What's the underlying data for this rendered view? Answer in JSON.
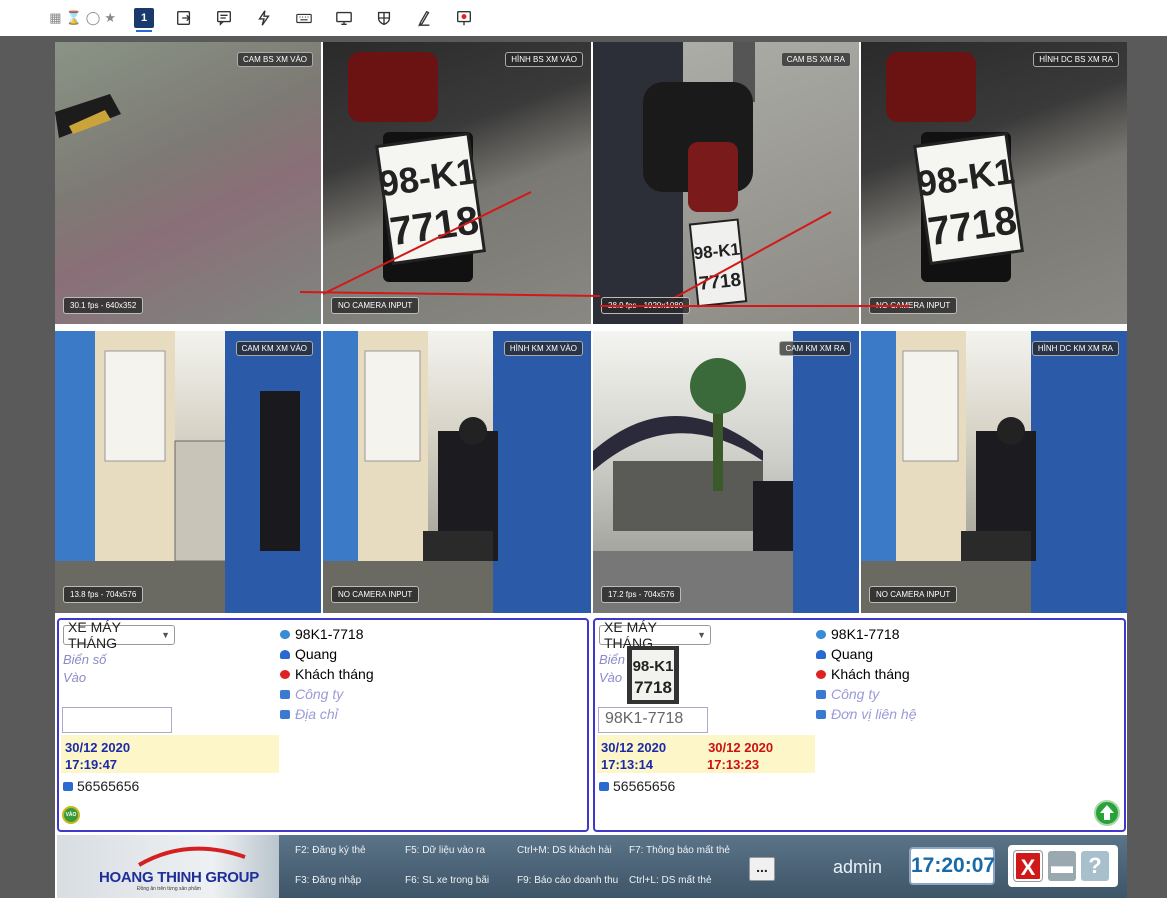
{
  "toolbar": {
    "left_icons": [
      "ruler-icon",
      "hourglass-icon",
      "cylinder-icon",
      "star-icon"
    ],
    "active_page": "1",
    "icons": [
      "page-1-icon",
      "exit-icon",
      "comment-icon",
      "bolt-icon",
      "keyboard-icon",
      "monitor-icon",
      "shield-icon",
      "pen-icon",
      "presentation-icon"
    ]
  },
  "cameras": [
    {
      "label": "CAM BS XM VÀO",
      "stat": "30.1 fps - 640x352"
    },
    {
      "label": "HÌNH BS XM VÀO",
      "stat": "NO CAMERA INPUT"
    },
    {
      "label": "CAM BS XM RA",
      "stat": "28.9 fps - 1920x1080"
    },
    {
      "label": "HÌNH DC BS XM RA",
      "stat": "NO CAMERA INPUT"
    },
    {
      "label": "CAM KM XM VÀO",
      "stat": "13.8 fps - 704x576"
    },
    {
      "label": "HÌNH KM XM VÀO",
      "stat": "NO CAMERA INPUT"
    },
    {
      "label": "CAM KM XM RA",
      "stat": "17.2 fps - 704x576"
    },
    {
      "label": "HÌNH DC KM XM RA",
      "stat": "NO CAMERA INPUT"
    }
  ],
  "plates": {
    "cam2_line1": "98-K1",
    "cam2_line2": "7718",
    "cam3_line1": "98-K1",
    "cam3_line2": "7718",
    "cam4_line1": "98-K1",
    "cam4_line2": "7718"
  },
  "left_panel": {
    "vehicle_type": "XE MÁY THÁNG",
    "label_plate": "Biển số",
    "label_in": "Vào",
    "plate_input": "",
    "date": "30/12 2020",
    "time": "17:19:47",
    "card": "56565656",
    "info": {
      "plate": "98K1-7718",
      "name": "Quang",
      "type": "Khách tháng",
      "company": "Công ty",
      "address": "Địa chỉ"
    },
    "badge": "VÀO"
  },
  "right_panel": {
    "vehicle_type": "XE MÁY THÁNG",
    "label_plate": "Biển",
    "label_in": "Vào",
    "thumb_line1": "98-K1",
    "thumb_line2": "7718",
    "plate_input": "98K1-7718",
    "date_in": "30/12 2020",
    "time_in": "17:13:14",
    "date_out": "30/12 2020",
    "time_out": "17:13:23",
    "card": "56565656",
    "info": {
      "plate": "98K1-7718",
      "name": "Quang",
      "type": "Khách tháng",
      "company": "Công ty",
      "contact": "Đơn vị liên hệ"
    }
  },
  "bottom": {
    "logo": "HOANG THINH GROUP",
    "logo_tagline": "Đồng ân trên từng sản phẩm",
    "f2": "F2: Đăng ký thẻ",
    "f3": "F3: Đăng nhập",
    "f5": "F5: Dữ liệu vào ra",
    "f6": "F6: SL xe trong bãi",
    "ctrl_m": "Ctrl+M: DS khách hài",
    "f9": "F9: Báo cáo doanh thu",
    "f7": "F7: Thông báo mất thẻ",
    "ctrl_l": "Ctrl+L: DS mất thẻ",
    "more": "...",
    "user": "admin",
    "clock": "17:20:07"
  },
  "colors": {
    "panel_border": "#4038c8",
    "time_highlight": "#fdf6c8",
    "out_time": "#cc1111",
    "clock_text": "#1b6aa8"
  }
}
